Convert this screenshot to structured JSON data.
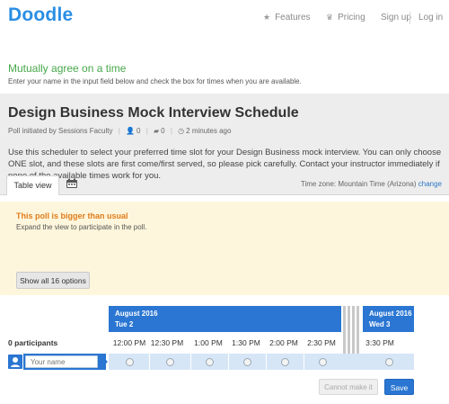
{
  "header": {
    "logo": "Doodle",
    "nav": {
      "features": "Features",
      "pricing": "Pricing",
      "signup": "Sign up",
      "login": "Log in"
    },
    "icons": {
      "features": "star-icon",
      "pricing": "crown-icon"
    }
  },
  "agree": {
    "title": "Mutually agree on a time",
    "subtitle": "Enter your name in the input field below and check the box for times when you are available."
  },
  "poll": {
    "title": "Design Business Mock Interview Schedule",
    "initiated_by": "Poll initiated by Sessions Faculty",
    "participants_count": "0",
    "comments_count": "0",
    "updated": "2 minutes ago",
    "description": "Use this scheduler to select your preferred time slot for your Design Business mock interview. You can only choose ONE slot, and these slots are first come/first served, so please pick carefully. Contact your instructor immediately if none of the available times work for you."
  },
  "tabs": {
    "table_view": "Table view",
    "calendar_icon": "calendar-icon"
  },
  "timezone": {
    "label": "Time zone: Mountain Time (Arizona)",
    "change": "change"
  },
  "warning": {
    "title": "This poll is bigger than usual",
    "subtitle": "Expand the view to participate in the poll.",
    "button": "Show all 16 options"
  },
  "table": {
    "participants_label": "0 participants",
    "dates": [
      {
        "month": "August 2016",
        "day": "Tue 2"
      },
      {
        "month": "August 2016",
        "day": "Wed 3"
      }
    ],
    "times_day1": [
      "12:00 PM",
      "12:30 PM",
      "1:00 PM",
      "1:30 PM",
      "2:00 PM",
      "2:30 PM"
    ],
    "times_day2": [
      "3:30 PM"
    ],
    "name_placeholder": "Your name"
  },
  "actions": {
    "cannot_make_it": "Cannot make it",
    "save": "Save"
  },
  "colors": {
    "brand_blue": "#2a8ee4",
    "header_blue": "#2a76d2",
    "agree_green": "#48a84a",
    "warning_orange": "#e07b1a",
    "warning_bg": "#fdf6dc"
  }
}
